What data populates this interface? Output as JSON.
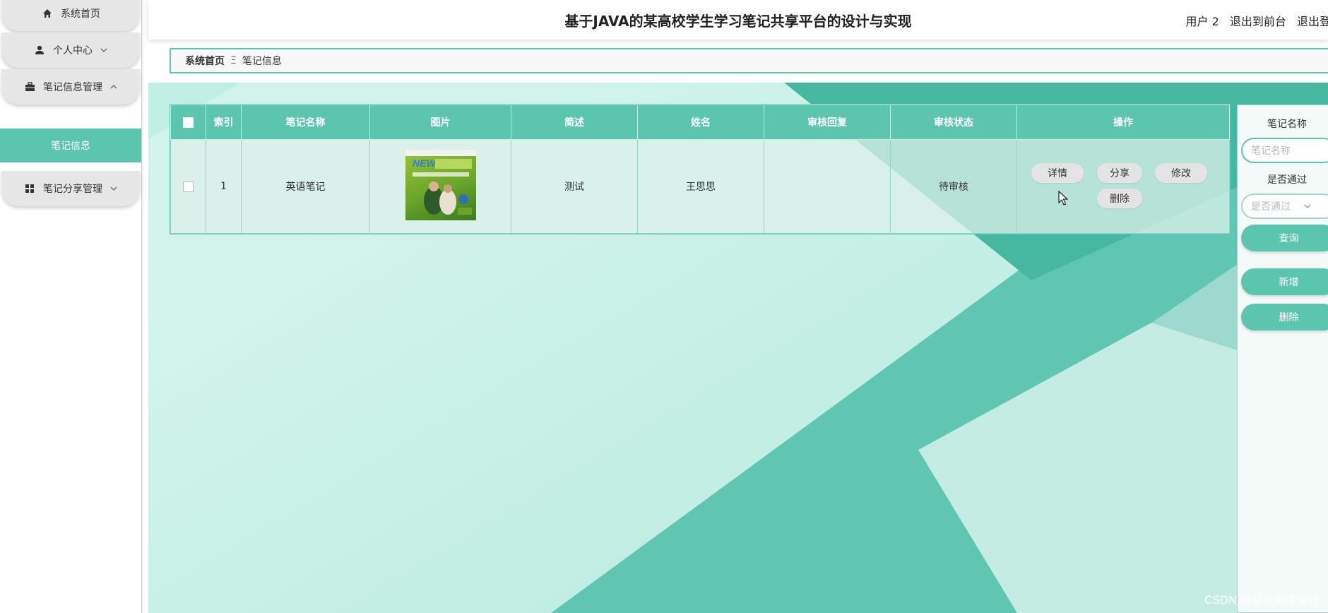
{
  "app": {
    "title": "基于JAVA的某高校学生学习笔记共享平台的设计与实现",
    "user_label": "用户 2",
    "goto_front": "退出到前台",
    "logout": "退出登"
  },
  "sidebar": {
    "items": [
      {
        "label": "系统首页",
        "icon": "home-icon"
      },
      {
        "label": "个人中心",
        "icon": "user-icon"
      },
      {
        "label": "笔记信息管理",
        "icon": "briefcase-icon"
      },
      {
        "label": "笔记信息",
        "icon": ""
      },
      {
        "label": "笔记分享管理",
        "icon": "grid-icon"
      }
    ]
  },
  "breadcrumb": {
    "home": "系统首页",
    "separator": "Ξ",
    "current": "笔记信息"
  },
  "table": {
    "columns": [
      "索引",
      "笔记名称",
      "图片",
      "简述",
      "姓名",
      "审核回复",
      "审核状态",
      "操作"
    ],
    "rows": [
      {
        "index": "1",
        "name": "英语笔记",
        "image_alt": "NEW 新起点 大学基础英语教程",
        "summary": "测试",
        "person": "王思思",
        "reply": "",
        "status": "待审核"
      }
    ],
    "actions": {
      "detail": "详情",
      "share": "分享",
      "edit": "修改",
      "delete": "删除"
    }
  },
  "search": {
    "name_label": "笔记名称",
    "name_placeholder": "笔记名称",
    "pass_label": "是否通过",
    "pass_placeholder": "是否通过",
    "query": "查询",
    "add": "新增",
    "delete": "删除"
  },
  "watermark": "CSDN @林文程序设计",
  "colors": {
    "accent": "#5cc5ae",
    "accent_dark": "#3fae96",
    "panel_bg": "#e6e6e6"
  }
}
